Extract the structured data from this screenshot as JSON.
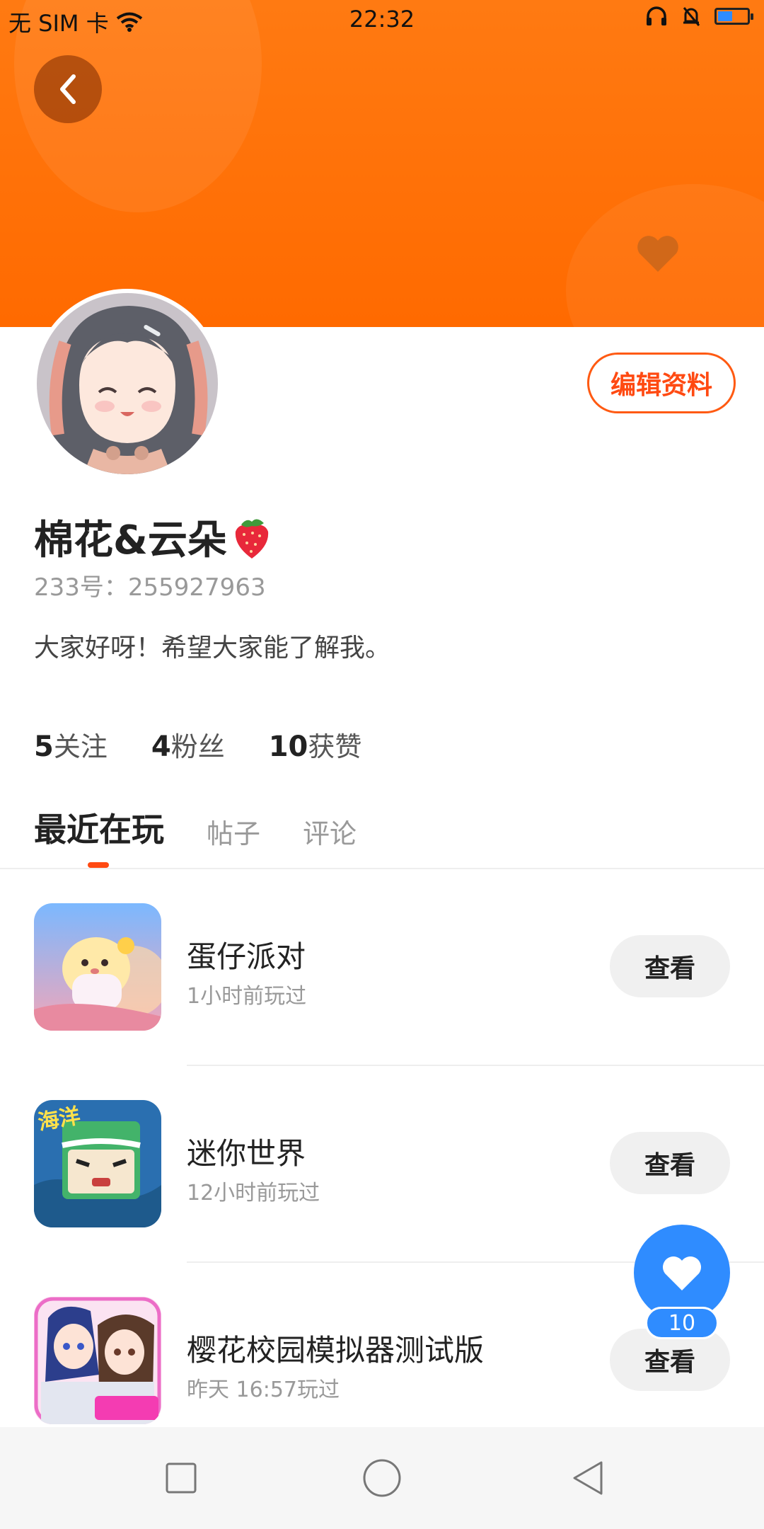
{
  "status_bar": {
    "carrier": "无 SIM 卡",
    "time": "22:32",
    "icons": [
      "wifi-icon",
      "headphones-icon",
      "mute-icon",
      "battery-icon"
    ],
    "battery_level": 0.45
  },
  "profile": {
    "edit_label": "编辑资料",
    "nickname": "棉花&云朵",
    "nickname_emoji": "strawberry",
    "uid_text": "233号：255927963",
    "bio": "大家好呀！希望大家能了解我。",
    "stats": [
      {
        "count": "5",
        "label": "关注"
      },
      {
        "count": "4",
        "label": "粉丝"
      },
      {
        "count": "10",
        "label": "获赞"
      }
    ]
  },
  "tabs": [
    {
      "label": "最近在玩",
      "active": true
    },
    {
      "label": "帖子",
      "active": false
    },
    {
      "label": "评论",
      "active": false
    }
  ],
  "games": [
    {
      "title": "蛋仔派对",
      "subtitle": "1小时前玩过",
      "action": "查看",
      "icon": "egg-party-icon"
    },
    {
      "title": "迷你世界",
      "subtitle": "12小时前玩过",
      "action": "查看",
      "icon": "mini-world-icon"
    },
    {
      "title": "樱花校园模拟器测试版",
      "subtitle": "昨天 16:57玩过",
      "action": "查看",
      "icon": "sakura-school-icon"
    }
  ],
  "floating_like": {
    "count": "10"
  },
  "colors": {
    "header": "#ff7a12",
    "accent": "#ff4a12",
    "like": "#2f8cff"
  }
}
